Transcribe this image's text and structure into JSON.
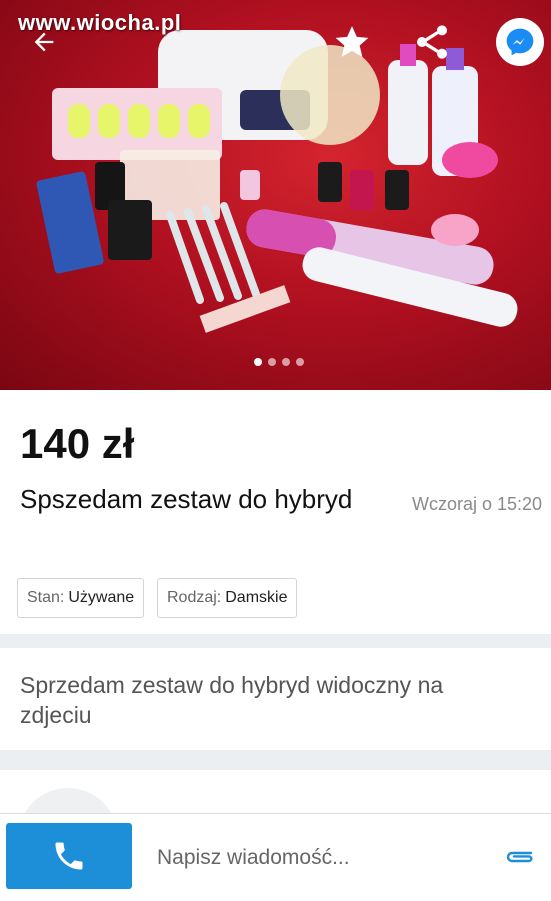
{
  "watermark": "www.wiocha.pl",
  "gallery": {
    "photo_description": "",
    "dots": [
      true,
      false,
      false,
      false
    ]
  },
  "listing": {
    "price": "140 zł",
    "title": "Spszedam zestaw do hybryd",
    "date": "Wczoraj o 15:20",
    "params": [
      {
        "key": "Stan:",
        "value": "Używane"
      },
      {
        "key": "Rodzaj:",
        "value": "Damskie"
      }
    ],
    "description": "Sprzedam zestaw do hybryd widoczny na zdjeciu"
  },
  "bottom": {
    "message_placeholder": "Napisz wiadomość..."
  },
  "colors": {
    "call_button": "#1d8fd8",
    "messenger": "#1a8cf3",
    "attach": "#1d8fd8"
  },
  "icons": [
    "back-arrow-icon",
    "star-icon",
    "share-icon",
    "messenger-icon",
    "phone-icon",
    "paperclip-icon"
  ]
}
